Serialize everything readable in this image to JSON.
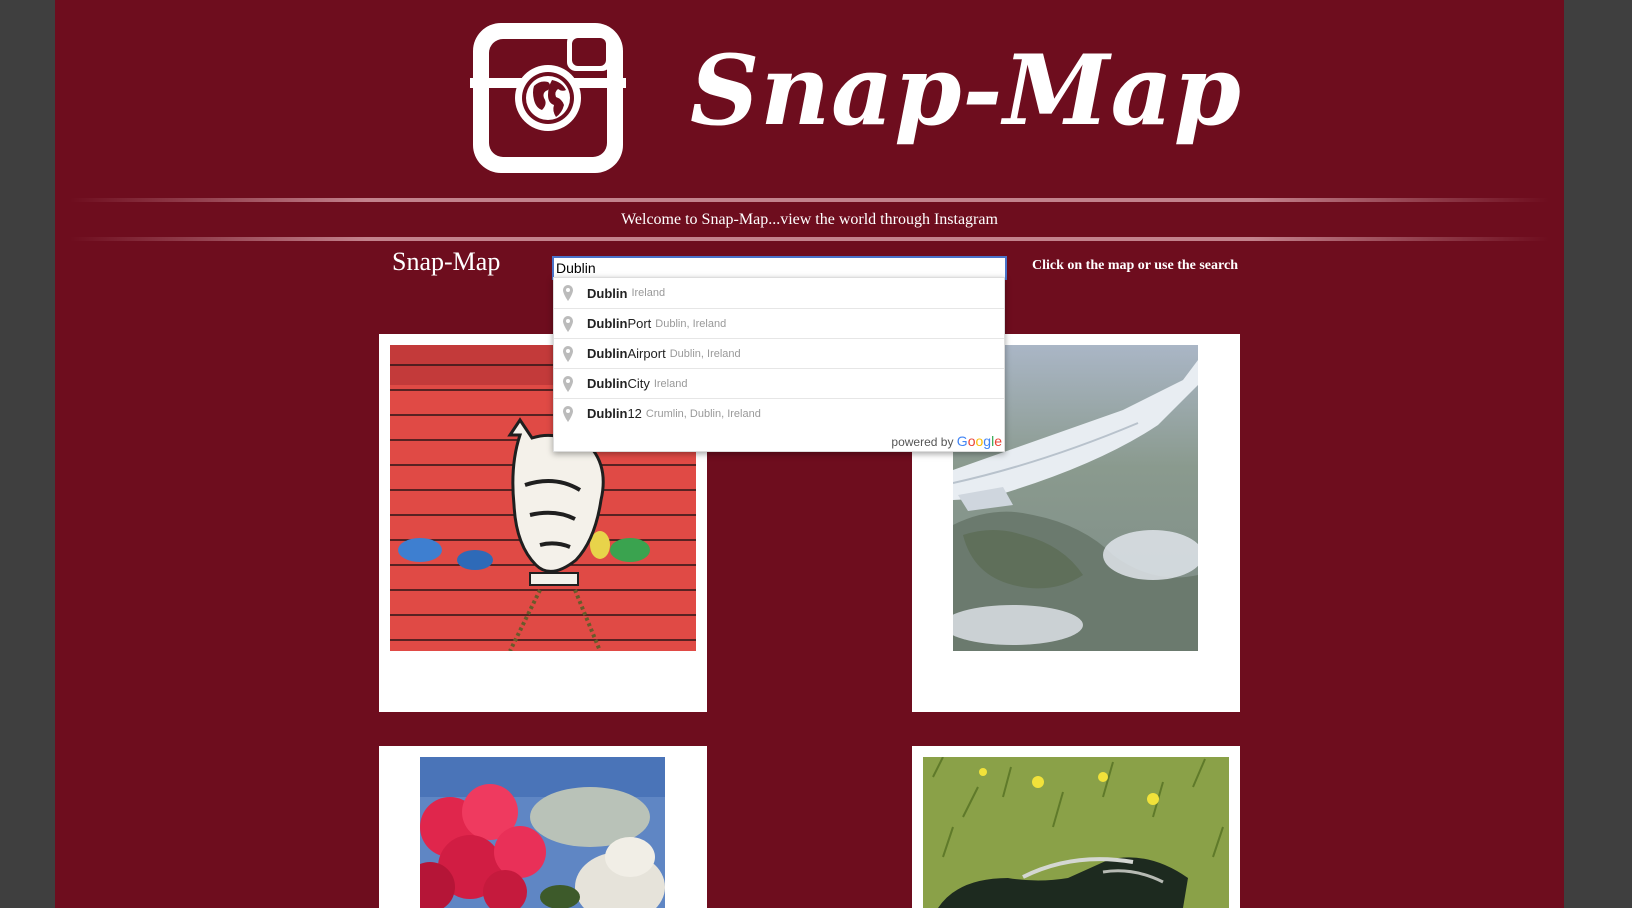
{
  "header": {
    "brand": "Snap-Map",
    "logo_icon": "instagram-camera-globe-icon"
  },
  "welcome_text": "Welcome to Snap-Map...view the world through Instagram",
  "subtitle": "Snap-Map",
  "search": {
    "value": "Dublin",
    "hint": "Click on the map or use the search"
  },
  "autocomplete": {
    "items": [
      {
        "match": "Dublin",
        "rest": "",
        "secondary": "Ireland"
      },
      {
        "match": "Dublin",
        "rest": " Port",
        "secondary": "Dublin, Ireland"
      },
      {
        "match": "Dublin",
        "rest": " Airport",
        "secondary": "Dublin, Ireland"
      },
      {
        "match": "Dublin",
        "rest": " City",
        "secondary": "Ireland"
      },
      {
        "match": "Dublin",
        "rest": " 12",
        "secondary": "Crumlin, Dublin, Ireland"
      }
    ],
    "powered_by": "powered by",
    "google_letters": [
      "G",
      "o",
      "o",
      "g",
      "l",
      "e"
    ]
  },
  "photos": [
    {
      "subject": "street-art-horse-mural"
    },
    {
      "subject": "airplane-wing-aerial-coast"
    },
    {
      "subject": "pink-geraniums"
    },
    {
      "subject": "sunglasses-on-grass"
    }
  ],
  "colors": {
    "page_bg": "#6e0d1e",
    "outer_bg": "#3f3f3f",
    "card_bg": "#ffffff",
    "search_border": "#4a73c9"
  }
}
